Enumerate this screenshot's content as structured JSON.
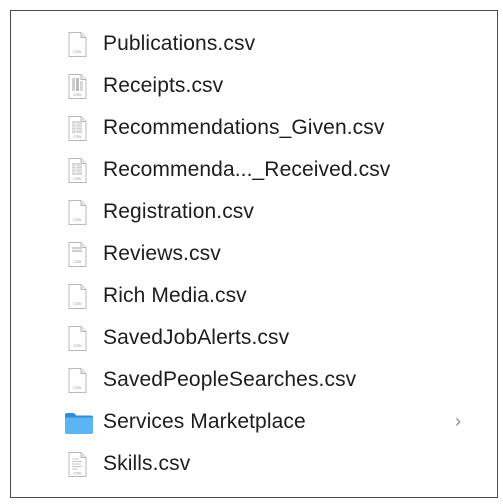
{
  "files": [
    {
      "name": "Publications.csv",
      "icon": "csv-file-icon"
    },
    {
      "name": "Receipts.csv",
      "icon": "csv-spreadsheet-icon"
    },
    {
      "name": "Recommendations_Given.csv",
      "icon": "csv-spreadsheet-icon"
    },
    {
      "name": "Recommenda..._Received.csv",
      "icon": "csv-spreadsheet-icon"
    },
    {
      "name": "Registration.csv",
      "icon": "csv-file-icon"
    },
    {
      "name": "Reviews.csv",
      "icon": "csv-spreadsheet-icon"
    },
    {
      "name": "Rich Media.csv",
      "icon": "csv-file-icon"
    },
    {
      "name": "SavedJobAlerts.csv",
      "icon": "csv-file-icon"
    },
    {
      "name": "SavedPeopleSearches.csv",
      "icon": "csv-file-icon"
    },
    {
      "name": "Services Marketplace",
      "icon": "folder-icon",
      "chevron": "›"
    },
    {
      "name": "Skills.csv",
      "icon": "csv-text-icon"
    }
  ],
  "colors": {
    "folder": "#3aa0e8",
    "text": "#1d1d1f",
    "chevron": "#8e8e93"
  }
}
